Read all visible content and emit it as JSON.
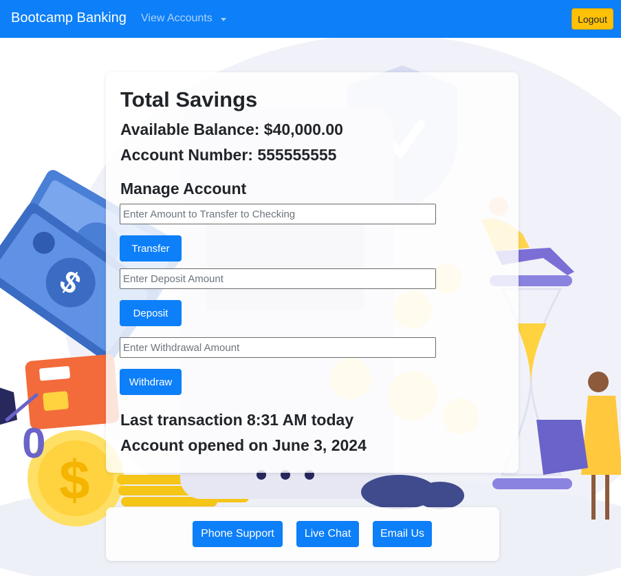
{
  "navbar": {
    "brand": "Bootcamp Banking",
    "dropdown_label": "View Accounts",
    "logout_label": "Logout"
  },
  "account": {
    "title": "Total Savings",
    "balance_line": "Available Balance: $40,000.00",
    "account_number_line": "Account Number: 555555555",
    "manage_heading": "Manage Account",
    "transfer": {
      "placeholder": "Enter Amount to Transfer to Checking",
      "button_label": "Transfer"
    },
    "deposit": {
      "placeholder": "Enter Deposit Amount",
      "button_label": "Deposit"
    },
    "withdraw": {
      "placeholder": "Enter Withdrawal Amount",
      "button_label": "Withdraw"
    },
    "last_transaction": "Last transaction 8:31 AM today",
    "opened_on": "Account opened on June 3, 2024"
  },
  "footer": {
    "buttons": [
      "Phone Support",
      "Live Chat",
      "Email Us"
    ]
  },
  "colors": {
    "primary": "#0d7ff8",
    "warning": "#ffc107"
  }
}
